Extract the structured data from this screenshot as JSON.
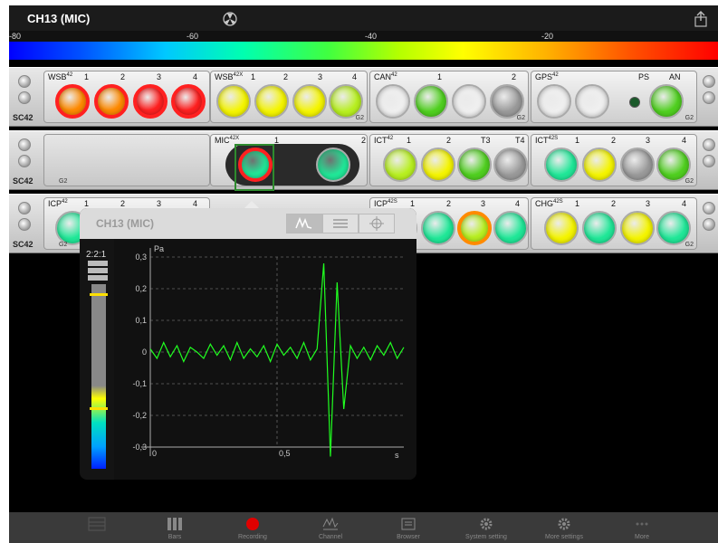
{
  "title": "CH13 (MIC)",
  "scale_labels": [
    "-80",
    "-60",
    "-40",
    "-20"
  ],
  "colors": {
    "red": "#ff2020",
    "orange": "#ff8a00",
    "yellow": "#f5f500",
    "lime": "#b8f020",
    "green": "#50d020",
    "teal": "#20e898",
    "white": "#f0f0f0",
    "gray": "#9a9a9a"
  },
  "racks": [
    {
      "label": "SC42",
      "cards": [
        {
          "name": "WSB",
          "sup": "42",
          "channels": [
            "1",
            "2",
            "3",
            "4"
          ],
          "leds": [
            {
              "fill": "orange",
              "ring": "red"
            },
            {
              "fill": "orange",
              "ring": "red"
            },
            {
              "fill": "red",
              "ring": "red"
            },
            {
              "fill": "red",
              "ring": "red"
            }
          ]
        },
        {
          "name": "WSB",
          "sup": "42X",
          "channels": [
            "1",
            "2",
            "3",
            "4"
          ],
          "leds": [
            {
              "fill": "yellow"
            },
            {
              "fill": "yellow"
            },
            {
              "fill": "yellow"
            },
            {
              "fill": "lime"
            }
          ]
        },
        {
          "name": "CAN",
          "sup": "42",
          "channels": [
            "1",
            "2"
          ],
          "leds": [
            {
              "fill": "white"
            },
            {
              "fill": "green"
            },
            {
              "fill": "white"
            },
            {
              "fill": "gray"
            }
          ]
        },
        {
          "name": "GPS",
          "sup": "42",
          "channels": [
            "PS",
            "AN"
          ],
          "leds": [
            {
              "fill": "white"
            },
            {
              "fill": "white"
            },
            {
              "fill": "green"
            }
          ]
        }
      ]
    },
    {
      "label": "SC42",
      "cards": [
        {
          "name": "MIC",
          "sup": "42X",
          "channels": [
            "1",
            "2"
          ],
          "leds": [
            {
              "fill": "teal",
              "ring": "red"
            },
            {
              "fill": "teal"
            }
          ]
        },
        {
          "name": "ICT",
          "sup": "42",
          "channels": [
            "1",
            "2",
            "T3",
            "T4"
          ],
          "leds": [
            {
              "fill": "lime"
            },
            {
              "fill": "yellow"
            },
            {
              "fill": "green"
            },
            {
              "fill": "gray"
            }
          ]
        },
        {
          "name": "ICT",
          "sup": "42S",
          "channels": [
            "1",
            "2",
            "3",
            "4"
          ],
          "leds": [
            {
              "fill": "teal"
            },
            {
              "fill": "yellow"
            },
            {
              "fill": "gray"
            },
            {
              "fill": "green"
            }
          ]
        }
      ]
    },
    {
      "label": "SC42",
      "cards": [
        {
          "name": "ICP",
          "sup": "42",
          "channels": [
            "1",
            "2",
            "3",
            "4"
          ],
          "leds": [
            {
              "fill": "teal"
            }
          ]
        },
        {
          "name": "ICP",
          "sup": "42S",
          "channels": [
            "1",
            "2",
            "3",
            "4"
          ],
          "leds": [
            {
              "fill": "teal"
            },
            {
              "fill": "teal"
            },
            {
              "fill": "lime",
              "ring": "orange"
            },
            {
              "fill": "teal"
            }
          ]
        },
        {
          "name": "CHG",
          "sup": "42S",
          "channels": [
            "1",
            "2",
            "3",
            "4"
          ],
          "leds": [
            {
              "fill": "yellow"
            },
            {
              "fill": "teal"
            },
            {
              "fill": "yellow"
            },
            {
              "fill": "teal"
            }
          ]
        }
      ]
    }
  ],
  "g2": "G2",
  "popup": {
    "title": "CH13 (MIC)",
    "zoom_ratio": "2:2:1",
    "tabs": [
      "waveform-icon",
      "list-icon",
      "crosshair-icon"
    ]
  },
  "chart_data": {
    "type": "line",
    "title": "",
    "unit_y": "Pa",
    "xlabel": "s",
    "yticks": [
      "0,3",
      "0,2",
      "0,1",
      "0",
      "-0,1",
      "-0,2",
      "-0,3"
    ],
    "yvals": [
      0.3,
      0.2,
      0.1,
      0,
      -0.1,
      -0.2,
      -0.3
    ],
    "xticks": [
      "0",
      "0,5"
    ],
    "xvals": [
      0,
      0.5
    ],
    "ylim": [
      -0.3,
      0.3
    ],
    "xlim": [
      0,
      1
    ],
    "grid": true,
    "series": [
      {
        "values": [
          0.01,
          -0.02,
          0.03,
          -0.015,
          0.02,
          -0.03,
          0.015,
          0.0,
          -0.02,
          0.025,
          -0.01,
          0.02,
          -0.025,
          0.03,
          -0.02,
          0.01,
          -0.015,
          0.02,
          -0.03,
          0.025,
          -0.01,
          0.015,
          -0.02,
          0.03,
          -0.025,
          0.01,
          0.28,
          -0.33,
          0.22,
          -0.18,
          0.02,
          -0.02,
          0.015,
          -0.025,
          0.02,
          -0.01,
          0.03,
          -0.02,
          0.015
        ]
      }
    ]
  },
  "level_meter": {
    "peak": "yellow",
    "low": "yellow"
  },
  "tabbar": [
    {
      "label": "",
      "icon": "grid-icon"
    },
    {
      "label": "Bars",
      "icon": "bars-icon"
    },
    {
      "label": "Recording",
      "icon": "record-icon"
    },
    {
      "label": "Channel",
      "icon": "channel-icon"
    },
    {
      "label": "Browser",
      "icon": "browser-icon"
    },
    {
      "label": "System setting",
      "icon": "gear-icon"
    },
    {
      "label": "More settings",
      "icon": "gear-icon"
    },
    {
      "label": "More",
      "icon": "more-icon"
    }
  ]
}
